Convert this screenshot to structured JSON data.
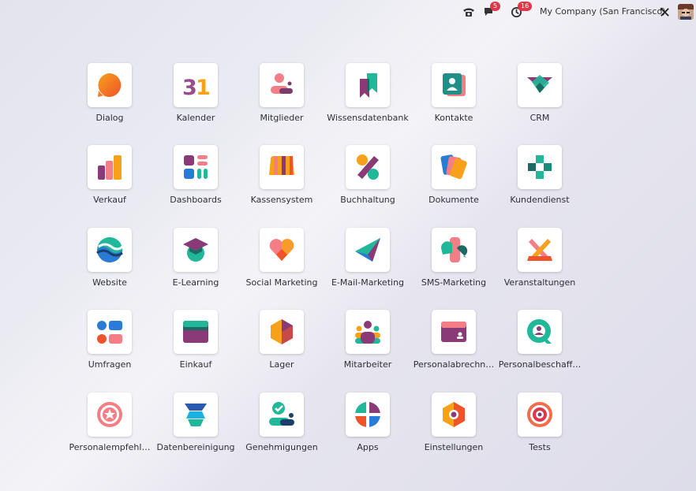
{
  "topbar": {
    "phone_icon": "phone-icon",
    "messages_icon": "chat-icon",
    "messages_count": "5",
    "activity_icon": "clock-icon",
    "activity_count": "16",
    "company": "My Company (San Francisco)",
    "debug_icon": "tools-icon",
    "avatar_icon": "user-avatar"
  },
  "apps": [
    {
      "label": "Dialog",
      "icon": "dialog-icon"
    },
    {
      "label": "Kalender",
      "icon": "calendar-icon"
    },
    {
      "label": "Mitglieder",
      "icon": "members-icon"
    },
    {
      "label": "Wissensdatenbank",
      "icon": "knowledge-icon"
    },
    {
      "label": "Kontakte",
      "icon": "contacts-icon"
    },
    {
      "label": "CRM",
      "icon": "crm-icon"
    },
    {
      "label": "Verkauf",
      "icon": "sales-icon"
    },
    {
      "label": "Dashboards",
      "icon": "dashboards-icon"
    },
    {
      "label": "Kassensystem",
      "icon": "pos-icon"
    },
    {
      "label": "Buchhaltung",
      "icon": "accounting-icon"
    },
    {
      "label": "Dokumente",
      "icon": "documents-icon"
    },
    {
      "label": "Kundendienst",
      "icon": "helpdesk-icon"
    },
    {
      "label": "Website",
      "icon": "website-icon"
    },
    {
      "label": "E-Learning",
      "icon": "elearning-icon"
    },
    {
      "label": "Social Marketing",
      "icon": "social-marketing-icon"
    },
    {
      "label": "E-Mail-Marketing",
      "icon": "email-marketing-icon"
    },
    {
      "label": "SMS-Marketing",
      "icon": "sms-marketing-icon"
    },
    {
      "label": "Veranstaltungen",
      "icon": "events-icon"
    },
    {
      "label": "Umfragen",
      "icon": "surveys-icon"
    },
    {
      "label": "Einkauf",
      "icon": "purchase-icon"
    },
    {
      "label": "Lager",
      "icon": "inventory-icon"
    },
    {
      "label": "Mitarbeiter",
      "icon": "employees-icon"
    },
    {
      "label": "Personalabrechn…",
      "icon": "payroll-icon"
    },
    {
      "label": "Personalbeschaff…",
      "icon": "recruitment-icon"
    },
    {
      "label": "Personalempfehl…",
      "icon": "referrals-icon"
    },
    {
      "label": "Datenbereinigung",
      "icon": "data-cleaning-icon"
    },
    {
      "label": "Genehmigungen",
      "icon": "approvals-icon"
    },
    {
      "label": "Apps",
      "icon": "apps-icon"
    },
    {
      "label": "Einstellungen",
      "icon": "settings-icon"
    },
    {
      "label": "Tests",
      "icon": "tests-icon"
    }
  ]
}
